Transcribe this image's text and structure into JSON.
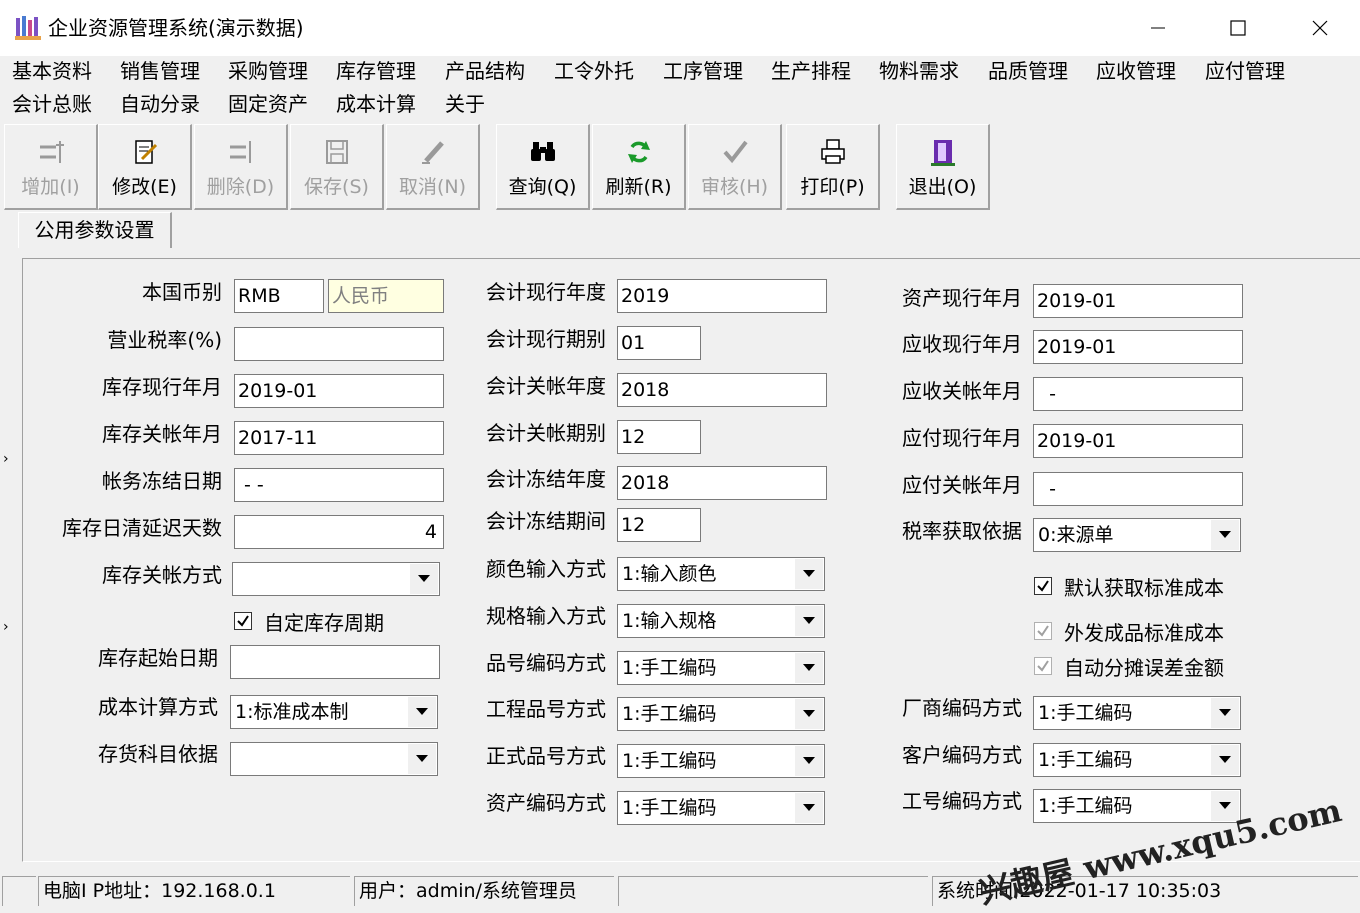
{
  "window": {
    "title": "企业资源管理系统(演示数据)"
  },
  "menu": [
    "基本资料",
    "销售管理",
    "采购管理",
    "库存管理",
    "产品结构",
    "工令外托",
    "工序管理",
    "生产排程",
    "物料需求",
    "品质管理",
    "应收管理",
    "应付管理",
    "会计总账",
    "自动分录",
    "固定资产",
    "成本计算",
    "关于"
  ],
  "toolbar": {
    "add": "增加(I)",
    "edit": "修改(E)",
    "delete": "删除(D)",
    "save": "保存(S)",
    "cancel": "取消(N)",
    "query": "查询(Q)",
    "refresh": "刷新(R)",
    "audit": "审核(H)",
    "print": "打印(P)",
    "exit": "退出(O)"
  },
  "tab": {
    "label": "公用参数设置"
  },
  "form": {
    "col1": {
      "currency_label": "本国币别",
      "currency_code": "RMB",
      "currency_name": "人民币",
      "tax_rate_label": "营业税率(%)",
      "tax_rate": "",
      "inv_cur_ym_label": "库存现行年月",
      "inv_cur_ym": "2019-01",
      "inv_close_ym_label": "库存关帐年月",
      "inv_close_ym": "2017-11",
      "freeze_date_label": "帐务冻结日期",
      "freeze_date": " - -",
      "delay_days_label": "库存日清延迟天数",
      "delay_days": "4",
      "close_method_label": "库存关帐方式",
      "close_method": "",
      "custom_period_label": "自定库存周期",
      "inv_start_label": "库存起始日期",
      "inv_start": "",
      "cost_method_label": "成本计算方式",
      "cost_method": "1:标准成本制",
      "stock_subject_label": "存货科目依据",
      "stock_subject": ""
    },
    "col2": {
      "acc_year_label": "会计现行年度",
      "acc_year": "2019",
      "acc_period_label": "会计现行期别",
      "acc_period": "01",
      "close_year_label": "会计关帐年度",
      "close_year": "2018",
      "close_period_label": "会计关帐期别",
      "close_period": "12",
      "freeze_year_label": "会计冻结年度",
      "freeze_year": "2018",
      "freeze_period_label": "会计冻结期间",
      "freeze_period": "12",
      "color_input_label": "颜色输入方式",
      "color_input": "1:输入颜色",
      "spec_input_label": "规格输入方式",
      "spec_input": "1:输入规格",
      "part_code_label": "品号编码方式",
      "part_code": "1:手工编码",
      "eng_part_label": "工程品号方式",
      "eng_part": "1:手工编码",
      "formal_part_label": "正式品号方式",
      "formal_part": "1:手工编码",
      "asset_code_label": "资产编码方式",
      "asset_code": "1:手工编码"
    },
    "col3": {
      "asset_ym_label": "资产现行年月",
      "asset_ym": "2019-01",
      "ar_ym_label": "应收现行年月",
      "ar_ym": "2019-01",
      "ar_close_label": "应收关帐年月",
      "ar_close": "  -",
      "ap_ym_label": "应付现行年月",
      "ap_ym": "2019-01",
      "ap_close_label": "应付关帐年月",
      "ap_close": "  -",
      "tax_basis_label": "税率获取依据",
      "tax_basis": "0:来源单",
      "default_std_cost_label": "默认获取标准成本",
      "outsource_std_cost_label": "外发成品标准成本",
      "auto_alloc_label": "自动分摊误差金额",
      "vendor_code_label": "厂商编码方式",
      "vendor_code": "1:手工编码",
      "customer_code_label": "客户编码方式",
      "customer_code": "1:手工编码",
      "emp_code_label": "工号编码方式",
      "emp_code": "1:手工编码"
    }
  },
  "status": {
    "ip": "电脑I P地址：192.168.0.1",
    "user": "用户：admin/系统管理员",
    "blank": "",
    "time": "系统时间:2022-01-17 10:35:03"
  },
  "watermark": "兴趣屋 www.xqu5.com",
  "colors": {
    "window_bg": "#f0f0f0",
    "title_bg": "#ffffff",
    "field_bg": "#ffffff",
    "highlight_field": "#ffffe1",
    "disabled_text": "#a0a0a0"
  }
}
